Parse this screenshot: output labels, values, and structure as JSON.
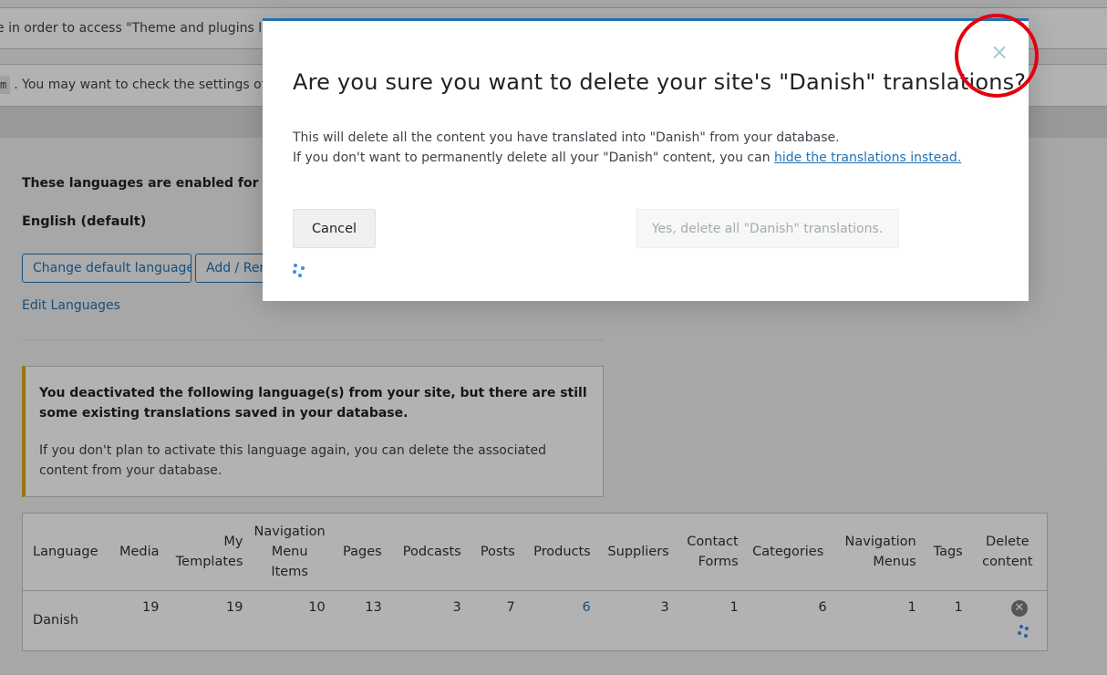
{
  "background": {
    "notice1_text": "e in order to access \"Theme and plugins locali",
    "notice2_code": "m",
    "notice2_text": ". You may want to check the settings of the",
    "enabled_text": "These languages are enabled for this site",
    "default_language": "English (default)",
    "change_default_label": "Change default language",
    "add_remove_label": "Add / Remove",
    "edit_languages_label": "Edit Languages",
    "warning": {
      "strong": "You deactivated the following language(s) from your site, but there are still some existing translations saved in your database.",
      "body": "If you don't plan to activate this language again, you can delete the associated content from your database."
    },
    "table": {
      "headers": [
        "Language",
        "Media",
        "My Templates",
        "Navigation Menu Items",
        "Pages",
        "Podcasts",
        "Posts",
        "Products",
        "Suppliers",
        "Contact Forms",
        "Categories",
        "Navigation Menus",
        "Tags",
        "Delete content"
      ],
      "row": [
        "Danish",
        "19",
        "19",
        "10",
        "13",
        "3",
        "7",
        "6",
        "3",
        "1",
        "6",
        "1",
        "1"
      ]
    }
  },
  "modal": {
    "title": "Are you sure you want to delete your site's \"Danish\" translations?",
    "body_line1": "This will delete all the content you have translated into \"Danish\" from your database.",
    "body_line2_prefix": "If you don't want to permanently delete all your \"Danish\" content, you can ",
    "body_link": "hide the translations instead.",
    "cancel_label": "Cancel",
    "confirm_label": "Yes, delete all \"Danish\" translations.",
    "close_glyph": "×"
  },
  "colors": {
    "accent": "#2271b1",
    "warning_border": "#dba617",
    "highlight": "#e3000f",
    "spinner": "#3a8ee6"
  }
}
